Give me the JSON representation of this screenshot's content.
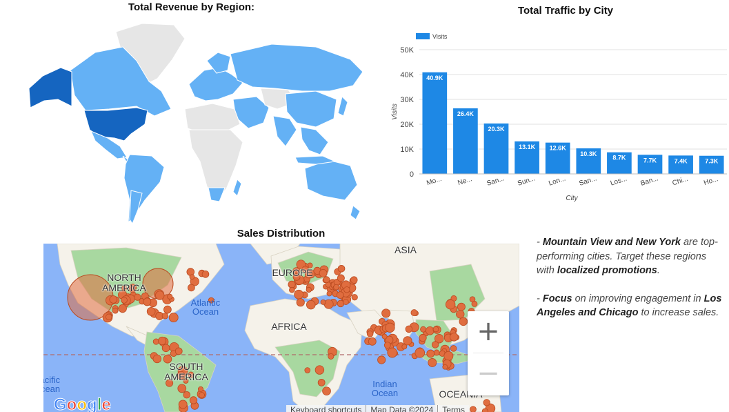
{
  "revenue_map": {
    "title": "Total Revenue by Region:",
    "colors": {
      "no_data": "#e6e6e6",
      "low": "#64b1f5",
      "mid": "#2a7fdc",
      "high": "#1565c0",
      "border": "#ffffff"
    }
  },
  "traffic_chart": {
    "title": "Total Traffic by City"
  },
  "chart_data": {
    "type": "bar",
    "title": "Total Traffic by City",
    "xlabel": "City",
    "ylabel": "Visits",
    "legend": {
      "label": "Visits",
      "position": "top-left"
    },
    "categories": [
      "Mo...",
      "Ne...",
      "San...",
      "Sun...",
      "Lon...",
      "San...",
      "Los...",
      "Ban...",
      "Chi...",
      "Ho..."
    ],
    "series": [
      {
        "name": "Visits",
        "values": [
          40900,
          26400,
          20300,
          13100,
          12600,
          10300,
          8700,
          7700,
          7400,
          7300
        ]
      }
    ],
    "data_labels": [
      "40.9K",
      "26.4K",
      "20.3K",
      "13.1K",
      "12.6K",
      "10.3K",
      "8.7K",
      "7.7K",
      "7.4K",
      "7.3K"
    ],
    "ylim": [
      0,
      50000
    ],
    "yticks": [
      0,
      10000,
      20000,
      30000,
      40000,
      50000
    ],
    "ytick_labels": [
      "0",
      "10K",
      "20K",
      "30K",
      "40K",
      "50K"
    ],
    "grid": true,
    "bar_color": "#1e88e5"
  },
  "sales_map": {
    "title": "Sales Distribution",
    "labels": {
      "north_america": "NORTH\nAMERICA",
      "europe": "EUROPE",
      "asia": "ASIA",
      "africa": "AFRICA",
      "south_america": "SOUTH\nAMERICA",
      "oceania": "OCEANIA",
      "atlantic": "Atlantic\nOcean",
      "indian": "Indian\nOcean",
      "pacific": "Pacific\nOcean"
    },
    "zoom_in": "+",
    "zoom_out": "−",
    "google_logo": "Google",
    "attribution": {
      "shortcuts": "Keyboard shortcuts",
      "map_data": "Map Data ©2024",
      "terms": "Terms"
    },
    "colors": {
      "water": "#8ab4f8",
      "land": "#f5f2ea",
      "veg": "#a8d8a0",
      "marker": "#e06d3f",
      "marker_stroke": "#b94a20",
      "equator": "#b06a6a"
    }
  },
  "insights": {
    "p1": {
      "lead": "- ",
      "highlight": "Mountain View and New York",
      "mid": " are top-performing cities. Target these regions with ",
      "highlight2": "localized promotions",
      "end": "."
    },
    "p2": {
      "lead": "- ",
      "highlight": "Focus",
      "mid": " on improving engagement in ",
      "highlight2": "Los Angeles and Chicago",
      "end": " to increase sales."
    }
  }
}
